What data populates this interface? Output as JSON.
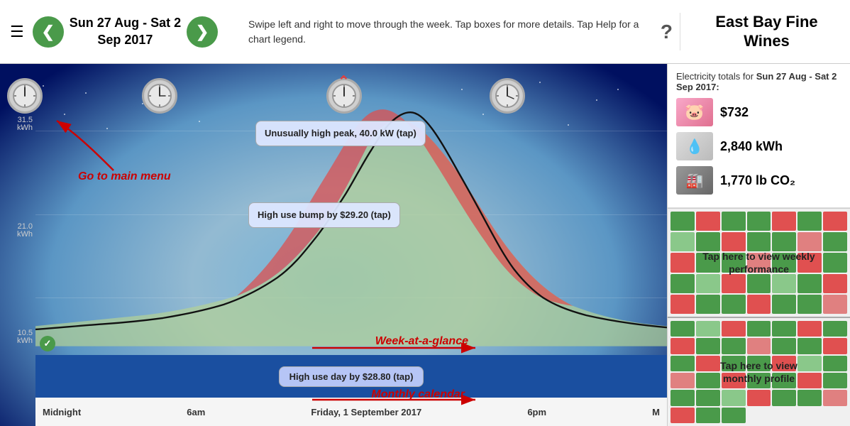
{
  "header": {
    "hamburger_label": "☰",
    "nav_left_label": "❮",
    "nav_right_label": "❯",
    "date_range": "Sun 27 Aug - Sat 2\nSep 2017",
    "instructions": "Swipe left and right to move through the week. Tap boxes for more details. Tap Help for a chart legend.",
    "help_label": "?",
    "title_line1": "East Bay Fine",
    "title_line2": "Wines"
  },
  "sidebar": {
    "period_label": "Electricity totals for ",
    "period_dates": "Sun 27 Aug - Sat 2 Sep 2017:",
    "stats": [
      {
        "icon": "piggy",
        "value": "$732",
        "id": "cost"
      },
      {
        "icon": "hand",
        "value": "2,840 kWh",
        "id": "energy"
      },
      {
        "icon": "smoke",
        "value": "1,770 lb CO₂",
        "id": "co2"
      }
    ],
    "weekly_label": "Tap here to view weekly\nperformance",
    "monthly_label": "Tap here to view\nmonthly profile"
  },
  "chart": {
    "y_labels": [
      "31.5 kWh",
      "21.0 kWh",
      "10.5 kWh"
    ],
    "x_labels": [
      "Midnight",
      "6am",
      "Friday, 1 September 2017",
      "6pm",
      "M"
    ],
    "tooltip_peak": "Unusually high peak,\n40.0 kW (tap)",
    "tooltip_bump": "High use bump by\n$29.20 (tap)",
    "tooltip_day": "High use day by $28.80\n(tap)",
    "annotation_menu": "Go to main menu",
    "annotation_week": "Week-at-a-glance",
    "annotation_monthly": "Monthly calendar"
  },
  "icons": {
    "hamburger": "☰",
    "arrow_left": "❮",
    "arrow_right": "❯",
    "checkmark": "✓",
    "question": "?"
  }
}
